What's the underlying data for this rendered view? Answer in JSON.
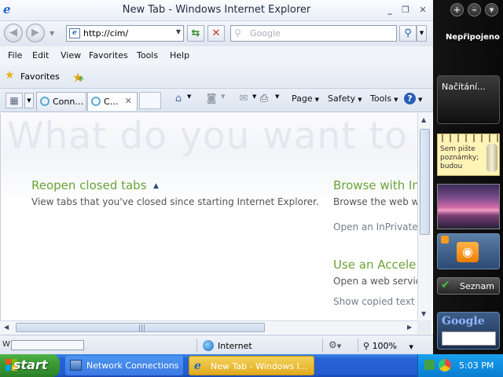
{
  "window": {
    "title": "New Tab - Windows Internet Explorer",
    "minimize": "_",
    "maximize": "❐",
    "close": "✕"
  },
  "address": {
    "url": "http://cim/",
    "search_placeholder": "Google",
    "refresh_symbol": "⇆",
    "stop_symbol": "✕"
  },
  "menu": [
    "File",
    "Edit",
    "View",
    "Favorites",
    "Tools",
    "Help"
  ],
  "favorites_bar": {
    "favorites_label": "Favorites"
  },
  "tabs": [
    {
      "label": "Conn…",
      "active": false
    },
    {
      "label": "C…",
      "active": true,
      "close": "✕"
    }
  ],
  "commands": {
    "page": "Page",
    "safety": "Safety",
    "tools": "Tools",
    "help": "?"
  },
  "content": {
    "hero": "What do you want to",
    "reopen_title": "Reopen closed tabs",
    "reopen_text": "View tabs that you've closed since starting Internet Explorer.",
    "browse_title": "Browse with In",
    "browse_text": "Browse the web wi",
    "browse_link": "Open an InPrivate",
    "accel_title": "Use an Accele",
    "accel_text": "Open a web servic",
    "accel_link": "Show copied text"
  },
  "status": {
    "left_char": "W",
    "zone": "Internet",
    "zoom": "100%"
  },
  "sidebar": {
    "status": "Nepřipojeno",
    "loading": "Načítání...",
    "notes_text": "Sem pište poznámky; budou",
    "seznam": "Seznam",
    "google_logo": "Google",
    "controls": [
      "+",
      "–",
      "▾"
    ]
  },
  "taskbar": {
    "start": "start",
    "tasks": [
      {
        "label": "Network Connections",
        "active": false
      },
      {
        "label": "New Tab - Windows I...",
        "active": true
      }
    ],
    "clock": "5:03 PM"
  },
  "colors": {
    "accent_green": "#6aa337",
    "taskbar_blue": "#225dd0",
    "start_green": "#3a9a35"
  }
}
